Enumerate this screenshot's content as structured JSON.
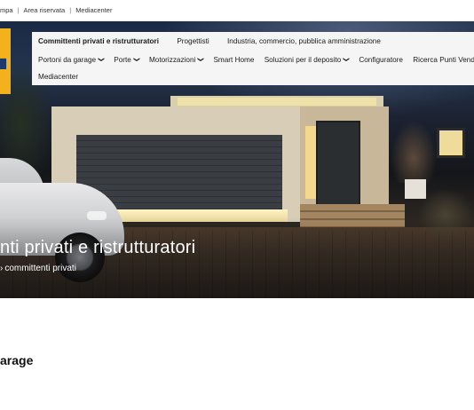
{
  "topbar": {
    "links": [
      "mpa",
      "Area riservata",
      "Mediacenter"
    ],
    "separator": "|"
  },
  "nav": {
    "row1": [
      {
        "label": "Committenti privati e ristrutturatori",
        "active": true
      },
      {
        "label": "Progettisti",
        "active": false
      },
      {
        "label": "Industria, commercio, pubblica amministrazione",
        "active": false
      }
    ],
    "row2": [
      {
        "label": "Portoni da garage",
        "dropdown": true
      },
      {
        "label": "Porte",
        "dropdown": true
      },
      {
        "label": "Motorizzazioni",
        "dropdown": true
      },
      {
        "label": "Smart Home",
        "dropdown": false
      },
      {
        "label": "Soluzioni per il deposito",
        "dropdown": true
      },
      {
        "label": "Configuratore",
        "dropdown": false
      },
      {
        "label": "Ricerca Punti Vendita",
        "dropdown": false
      }
    ],
    "row3": "Mediacenter"
  },
  "hero": {
    "title": "nti privati e ristrutturatori",
    "subtitle": "committenti privati"
  },
  "section": {
    "title": "arage"
  },
  "colors": {
    "logo": "#f3b21c",
    "nav_bg": "#f5f5f5"
  }
}
